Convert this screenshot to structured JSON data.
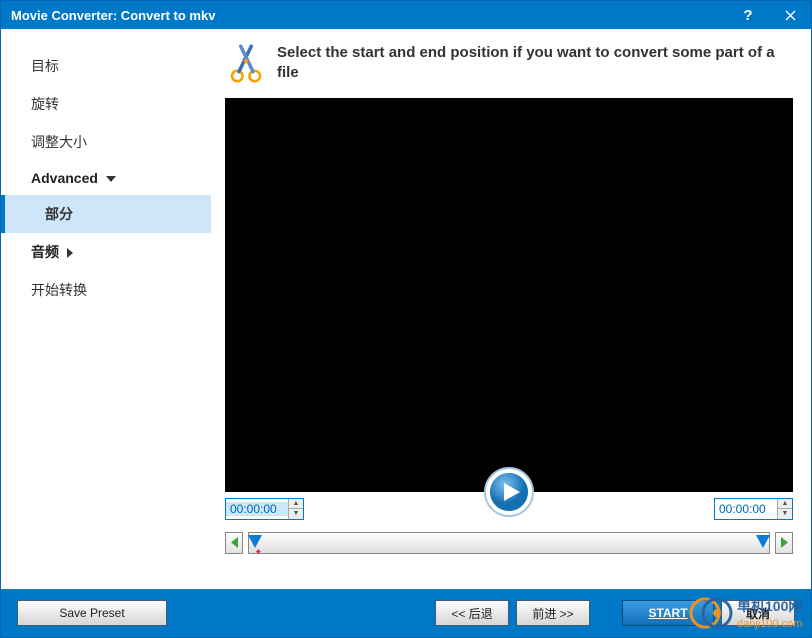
{
  "titlebar": {
    "title": "Movie Converter:  Convert to mkv"
  },
  "sidebar": {
    "items": [
      {
        "label": "目标"
      },
      {
        "label": "旋转"
      },
      {
        "label": "调整大小"
      },
      {
        "label": "Advanced",
        "type": "expand"
      },
      {
        "label": "部分",
        "type": "selected"
      },
      {
        "label": "音频",
        "type": "submenu"
      },
      {
        "label": "开始转换"
      }
    ]
  },
  "main": {
    "heading": "Select the start and end position if you want to convert some part of a file",
    "start_time": "00:00:00",
    "end_time": "00:00:00"
  },
  "footer": {
    "save_preset": "Save Preset",
    "back": "<< 后退",
    "forward": "前进 >>",
    "start": "START",
    "cancel": "取消"
  },
  "watermark": {
    "brand": "单机100网",
    "url": "danji100.com"
  }
}
